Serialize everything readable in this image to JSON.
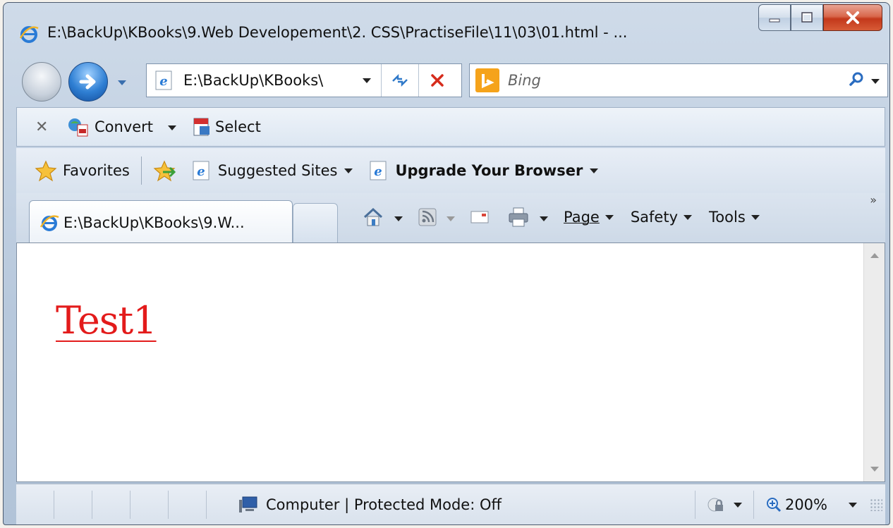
{
  "window": {
    "title": "E:\\BackUp\\KBooks\\9.Web Developement\\2. CSS\\PractiseFile\\11\\03\\01.html - ...",
    "minimize_icon": "minimize-icon",
    "maximize_icon": "maximize-icon",
    "close_icon": "close-icon"
  },
  "nav": {
    "address_value": "E:\\BackUp\\KBooks\\",
    "search_placeholder": "Bing"
  },
  "convert_toolbar": {
    "convert_label": "Convert",
    "select_label": "Select"
  },
  "favorites_bar": {
    "favorites_label": "Favorites",
    "suggested_sites_label": "Suggested Sites",
    "upgrade_label": "Upgrade Your Browser"
  },
  "tabs": [
    {
      "label": "E:\\BackUp\\KBooks\\9.W..."
    }
  ],
  "command_bar": {
    "page_label": "Page",
    "safety_label": "Safety",
    "tools_label": "Tools",
    "more_label": "»"
  },
  "content": {
    "link_text": "Test1",
    "link_color": "#e31b1b"
  },
  "status_bar": {
    "zone_text": "Computer | Protected Mode: Off",
    "zoom_text": "200%"
  }
}
